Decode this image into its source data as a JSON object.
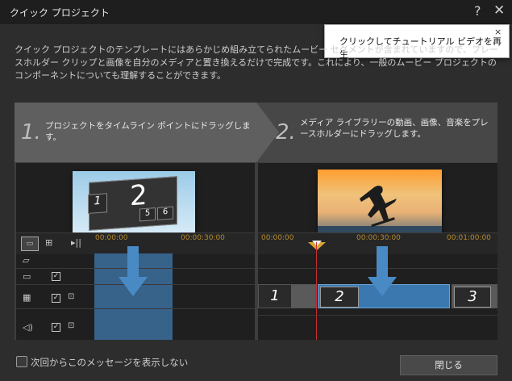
{
  "window": {
    "title": "クイック プロジェクト",
    "help_icon": "?",
    "close_icon": "✕"
  },
  "tooltip": {
    "text": "クリックしてチュートリアル ビデオを再生",
    "close_icon": "×"
  },
  "description": "クイック プロジェクトのテンプレートにはあらかじめ組み立てられたムービー セグメントが含まれていますので、プレースホルダー クリップと画像を自分のメディアと置き換えるだけで完成です。これにより、一般のムービー プロジェクトのコンポーネントについても理解することができます。",
  "steps": [
    {
      "number": "1.",
      "text": "プロジェクトをタイムライン ポイントにドラッグします。"
    },
    {
      "number": "2.",
      "text": "メディア ライブラリーの動画、画像、音楽をプレースホルダーにドラッグします。"
    }
  ],
  "left_demo": {
    "template_numbers": [
      "1",
      "2",
      "5",
      "6"
    ],
    "ruler_labels": [
      "00:00:00",
      "00:00:30:00"
    ],
    "tracks": [
      {
        "icon": "subtitle-icon",
        "checked": false,
        "locked": false
      },
      {
        "icon": "title-track-icon",
        "checked": true,
        "locked": false
      },
      {
        "icon": "video-track-icon",
        "checked": true,
        "locked": true
      },
      {
        "icon": "audio-track-icon",
        "checked": true,
        "locked": true
      }
    ],
    "check_glyph": "✓",
    "lock_glyph": "🔓"
  },
  "right_demo": {
    "ruler_labels": [
      "00:00:00",
      "00:00:30:00",
      "00:01:00:00"
    ],
    "clips": [
      "1",
      "2",
      "3"
    ]
  },
  "footer": {
    "dont_show_label": "次回からこのメッセージを表示しない",
    "dont_show_checked": false,
    "close_button": "閉じる"
  },
  "colors": {
    "accent_blue": "#4a8ac4",
    "timeline_orange": "#b58a2e",
    "playhead_red": "#c83030"
  }
}
